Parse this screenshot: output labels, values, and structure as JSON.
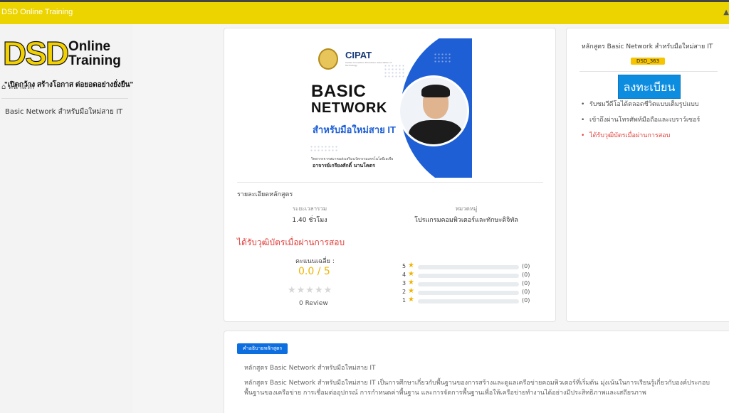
{
  "topbar": {
    "brand": "DSD Online Training",
    "caret": "▲"
  },
  "sidebar": {
    "logo": {
      "dsd": "DSD",
      "online": "Online",
      "training": "Training",
      "slogan": "\"เปิดกว้าง สร้างโอกาส ต่อยอดอย่างยั่งยืน\""
    },
    "home_label": "หน้าแรก",
    "home_icon": "home-icon",
    "course_link": "Basic Network สำหรับมือใหม่สาย IT"
  },
  "banner": {
    "org": "CIPAT",
    "org_sub": "Center Innovation Promotion Association of Technology",
    "title_line1": "BASIC",
    "title_line2": "NETWORK",
    "subtitle": "สำหรับมือใหม่สาย IT",
    "speaker_role": "วิทยากรจากสมาคมส่งเสริมนวัตกรรมเทคโนโลยีเอเชีย",
    "speaker_name": "อาจารย์เกรียงศักดิ์ นานโคตร",
    "accent": "#1e5fd6"
  },
  "details": {
    "section_title": "รายละเอียดหลักสูตร",
    "duration_label": "ระยะเวลารวม",
    "duration_value": "1.40 ชั่วโมง",
    "category_label": "หมวดหมู่",
    "category_value": "โปรแกรมคอมพิวเตอร์และทักษะดิจิทัล",
    "certificate": "ได้รับวุฒิบัตรเมื่อผ่านการสอบ",
    "average_label": "คะแนนเฉลี่ย :",
    "average_value": "0.0 / 5",
    "stars": "★★★★★",
    "review_count": "0 Review",
    "distribution": [
      {
        "stars": "5",
        "count": "(0)",
        "fraction": 0
      },
      {
        "stars": "4",
        "count": "(0)",
        "fraction": 0
      },
      {
        "stars": "3",
        "count": "(0)",
        "fraction": 0
      },
      {
        "stars": "2",
        "count": "(0)",
        "fraction": 0
      },
      {
        "stars": "1",
        "count": "(0)",
        "fraction": 0
      }
    ]
  },
  "side_panel": {
    "title": "หลักสูตร Basic Network สำหรับมือใหม่สาย IT",
    "code": "DSD_363",
    "register_label": "ลงทะเบียน",
    "features": [
      {
        "text": "รับชมวีดีโอได้ตลอดชีวิตแบบเต็มรูปแบบ",
        "red": false
      },
      {
        "text": "เข้าถึงผ่านโทรศัพท์มือถือและเบราว์เซอร์",
        "red": false
      },
      {
        "text": "ได้รับวุฒิบัตรเมื่อผ่านการสอบ",
        "red": true
      }
    ]
  },
  "description": {
    "tag": "คำอธิบายหลักสูตร",
    "title": "หลักสูตร Basic Network สำหรับมือใหม่สาย IT",
    "body": "หลักสูตร Basic Network  สำหรับมือใหม่สาย IT เป็นการศึกษาเกี่ยวกับพื้นฐานของการสร้างและดูแลเครือข่ายคอมพิวเตอร์ที่เริ่มต้น มุ่งเน้นในการเรียนรู้เกี่ยวกับองค์ประกอบพื้นฐานของเครือข่าย การเชื่อมต่ออุปกรณ์ การกำหนดค่าพื้นฐาน และการจัดการพื้นฐานเพื่อให้เครือข่ายทำงานได้อย่างมีประสิทธิภาพและเสถียรภาพ"
  }
}
